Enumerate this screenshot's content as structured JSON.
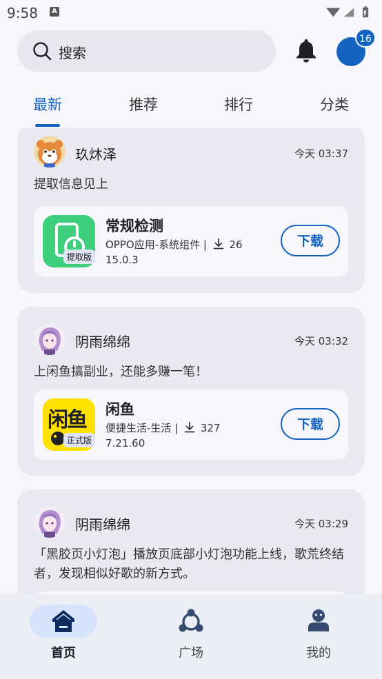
{
  "status_bar": {
    "time": "9:58",
    "notification_icon": "A"
  },
  "header": {
    "search_placeholder": "搜索",
    "notification_badge": "16"
  },
  "tabs": [
    {
      "label": "最新",
      "active": true
    },
    {
      "label": "推荐",
      "active": false
    },
    {
      "label": "排行",
      "active": false
    },
    {
      "label": "分类",
      "active": false
    }
  ],
  "posts": [
    {
      "user": "玖炑泽",
      "time": "今天 03:37",
      "text": "提取信息见上",
      "app": {
        "name": "常规检测",
        "meta": "OPPO应用-系统组件 |",
        "downloads": "26",
        "version": "15.0.3",
        "tag": "提取版",
        "download_label": "下载"
      }
    },
    {
      "user": "阴雨绵绵",
      "time": "今天 03:32",
      "text": "上闲鱼搞副业，还能多赚一笔！",
      "app": {
        "name": "闲鱼",
        "meta": "便捷生活-生活 |",
        "downloads": "327",
        "version": "7.21.60",
        "tag": "正式版",
        "icon_text": "闲鱼",
        "download_label": "下载"
      }
    },
    {
      "user": "阴雨绵绵",
      "time": "今天 03:29",
      "text": "「黑胶页小灯泡」播放页底部小灯泡功能上线，歌荒终结者，发现相似好歌的新方式。"
    }
  ],
  "bottom_nav": [
    {
      "label": "首页",
      "icon": "home-icon",
      "active": true
    },
    {
      "label": "广场",
      "icon": "share-icon",
      "active": false
    },
    {
      "label": "我的",
      "icon": "profile-icon",
      "active": false
    }
  ],
  "colors": {
    "accent": "#1565c0",
    "card": "#e9eaf1",
    "background": "#f6f6fb"
  }
}
